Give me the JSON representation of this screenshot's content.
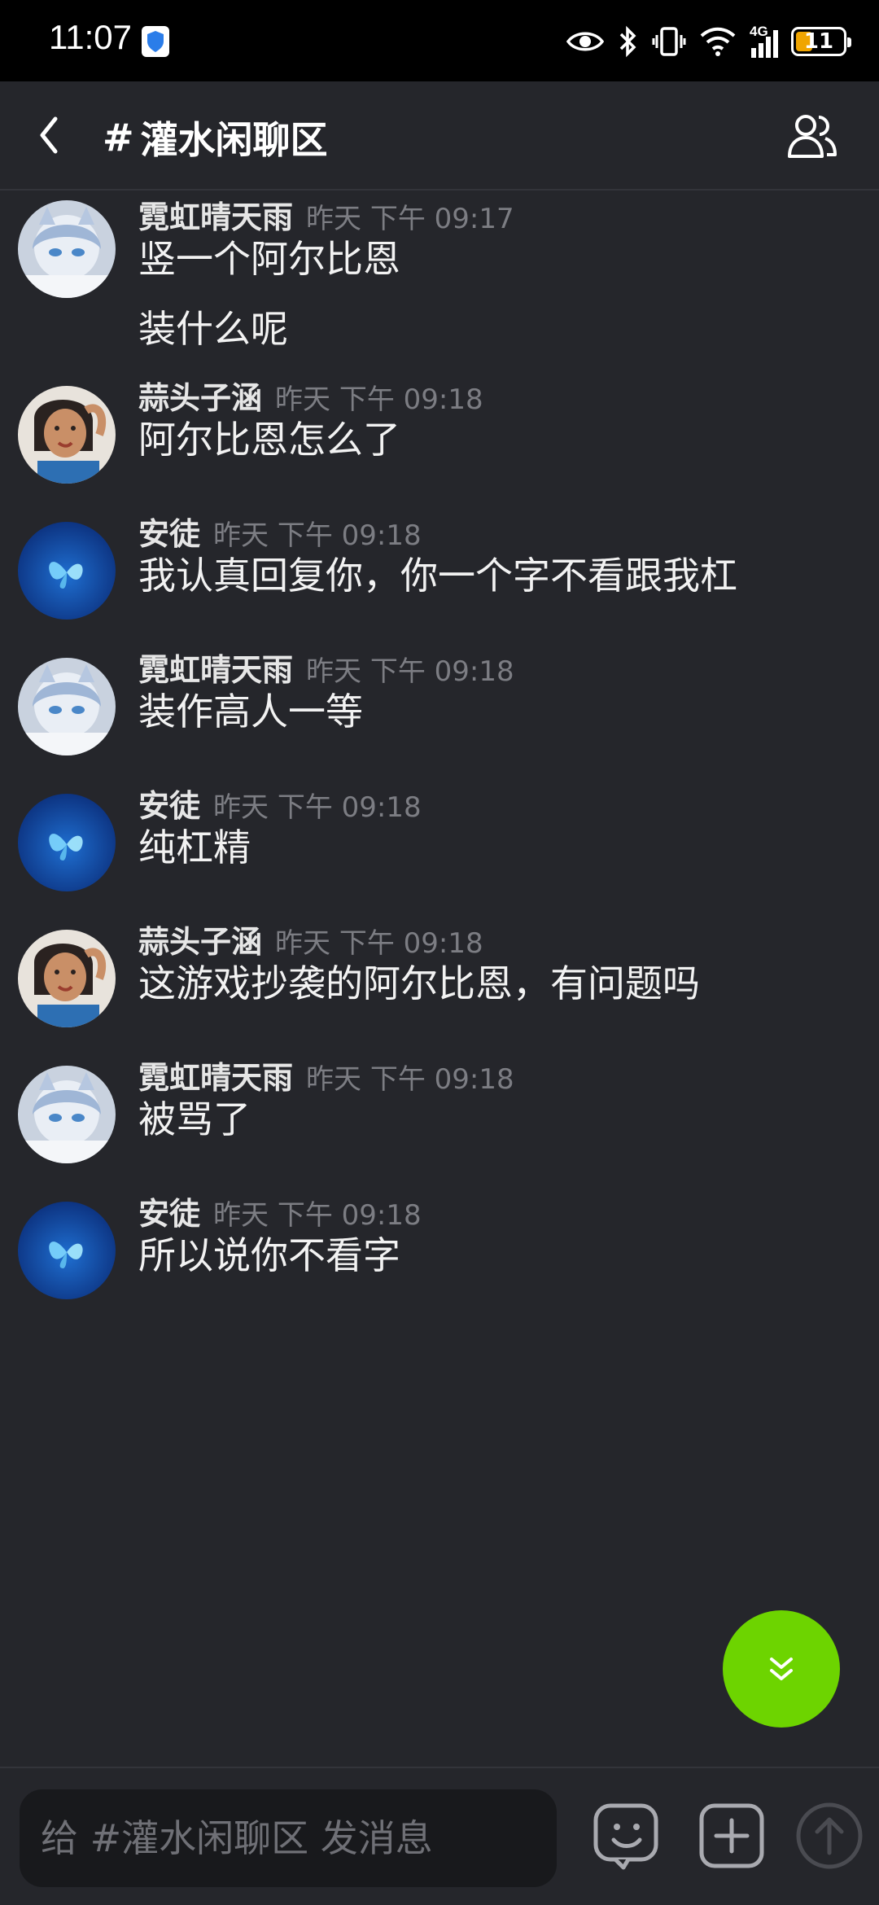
{
  "status_bar": {
    "time": "11:07",
    "network": "4G",
    "battery": "11"
  },
  "header": {
    "hash": "#",
    "title": "灌水闲聊区"
  },
  "messages": [
    {
      "user": "霓虹晴天雨",
      "time": "昨天 下午 09:17",
      "lines": [
        "竖一个阿尔比恩",
        "装什么呢"
      ],
      "avatar": "anime-girl-avatar"
    },
    {
      "user": "蒜头子涵",
      "time": "昨天 下午 09:18",
      "lines": [
        "阿尔比恩怎么了"
      ],
      "avatar": "photo-avatar"
    },
    {
      "user": "安徒",
      "time": "昨天 下午 09:18",
      "lines": [
        "我认真回复你，你一个字不看跟我杠"
      ],
      "avatar": "blue-butterfly-avatar"
    },
    {
      "user": "霓虹晴天雨",
      "time": "昨天 下午 09:18",
      "lines": [
        "装作高人一等"
      ],
      "avatar": "anime-girl-avatar"
    },
    {
      "user": "安徒",
      "time": "昨天 下午 09:18",
      "lines": [
        "纯杠精"
      ],
      "avatar": "blue-butterfly-avatar"
    },
    {
      "user": "蒜头子涵",
      "time": "昨天 下午 09:18",
      "lines": [
        "这游戏抄袭的阿尔比恩，有问题吗"
      ],
      "avatar": "photo-avatar"
    },
    {
      "user": "霓虹晴天雨",
      "time": "昨天 下午 09:18",
      "lines": [
        "被骂了"
      ],
      "avatar": "anime-girl-avatar"
    },
    {
      "user": "安徒",
      "time": "昨天 下午 09:18",
      "lines": [
        "所以说你不看字"
      ],
      "avatar": "blue-butterfly-avatar"
    }
  ],
  "composer": {
    "placeholder": "给 #灌水闲聊区 发消息"
  },
  "colors": {
    "background": "#25262b",
    "accent_green": "#6dd400",
    "input_bg": "#18191c"
  }
}
